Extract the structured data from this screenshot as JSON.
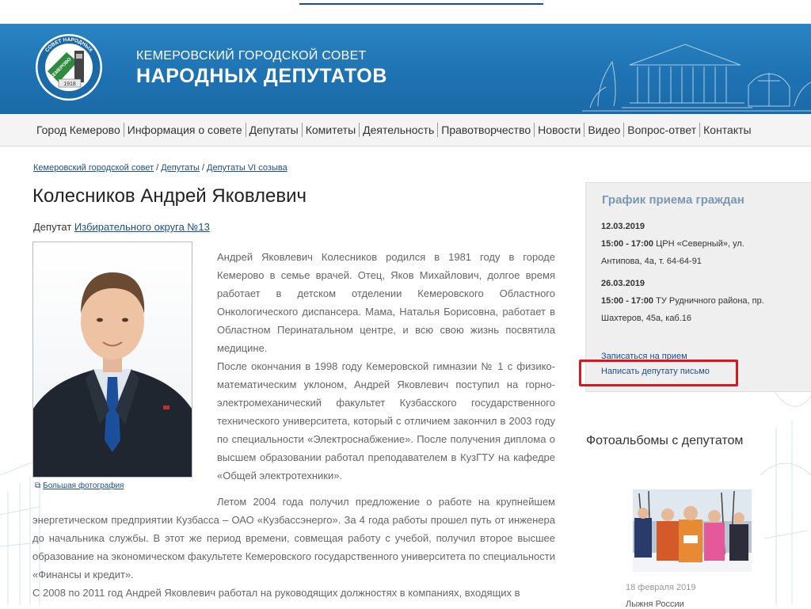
{
  "header": {
    "title_line1": "КЕМЕРОВСКИЙ ГОРОДСКОЙ СОВЕТ",
    "title_line2": "НАРОДНЫХ ДЕПУТАТОВ",
    "logo_text_top": "СОВЕТ НАРОДНЫХ",
    "logo_text_city": "КЕМЕРОВО",
    "logo_year": "1918"
  },
  "nav": {
    "items": [
      "Город Кемерово",
      "Информация о совете",
      "Депутаты",
      "Комитеты",
      "Деятельность",
      "Правотворчество",
      "Новости",
      "Видео",
      "Вопрос-ответ",
      "Контакты"
    ]
  },
  "breadcrumb": {
    "items": [
      "Кемеровский городской совет",
      "Депутаты",
      "Депутаты VI созыва"
    ],
    "separator": "/"
  },
  "deputy": {
    "name": "Колесников Андрей Яковлевич",
    "role_prefix": "Депутат",
    "district_link": "Избирательного округа №13",
    "photo_link": "Большая фотография"
  },
  "bio": {
    "p1": "Андрей Яковлевич Колесников родился в 1981 году в городе Кемерово в семье врачей. Отец, Яков Михайлович, долгое время работает в детском отделении Кемеровского Областного Онкологического диспансера. Мама, Наталья Борисовна, работает в Областном Перинатальном центре, и всю свою жизнь посвятила медицине.",
    "p2": "После окончания в 1998 году Кемеровской гимназии № 1 с физико-математическим уклоном, Андрей Яковлевич поступил на горно-электромеханический факультет Кузбасского государственного технического университета, который с отличием закончил в 2003 году по специальности «Электроснабжение». После получения диплома о высшем образовании работал преподавателем в КузГТУ на кафедре «Общей электротехники».",
    "p3": "Летом 2004 года получил предложение о работе на крупнейшем энергетическом предприятии Кузбасса – ОАО «Кузбассэнерго». За 4 года работы прошел путь от инженера до начальника службы. В этот же период времени, совмещая работу с учебой, получил второе высшее образование на экономическом факультете Кемеровского государственного университета по специальности «Финансы и кредит».",
    "p4": "С 2008 по 2011 год Андрей Яковлевич работал на руководящих должностях в компаниях, входящих в"
  },
  "reception": {
    "title": "График приема граждан",
    "entries": [
      {
        "date": "12.03.2019",
        "time": "15:00 - 17:00",
        "place": "ЦРН «Северный», ул. Антипова, 4а, т. 64-64-91"
      },
      {
        "date": "26.03.2019",
        "time": "15:00 - 17:00",
        "place": "ТУ Рудничного района, пр. Шахтеров, 45а, каб.16"
      }
    ],
    "link_appointment": "Записаться на прием",
    "link_letter": "Написать депутату письмо"
  },
  "albums": {
    "title": "Фотоальбомы с депутатом",
    "date": "18 февраля 2019",
    "caption": "Лыжня России"
  },
  "colors": {
    "header_blue": "#1f73b3",
    "link": "#1a4f8a",
    "highlight": "#e0141b",
    "panel_bg": "#efefef",
    "panel_title": "#7a98b0"
  }
}
